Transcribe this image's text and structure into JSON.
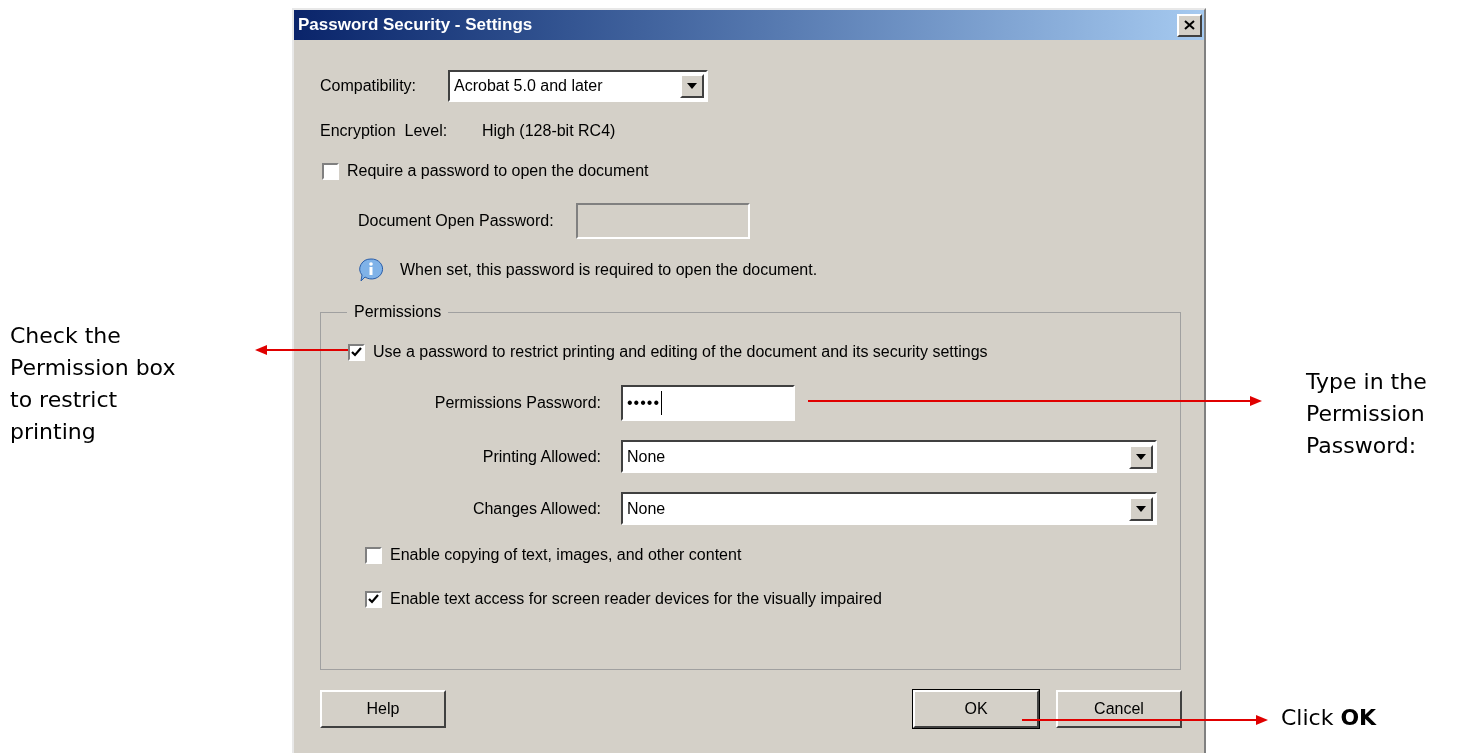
{
  "window": {
    "title": "Password Security - Settings"
  },
  "compatibility": {
    "label": "Compatibility:",
    "value": "Acrobat 5.0 and later"
  },
  "encryption": {
    "label": "Encryption  Level:",
    "value": "High (128-bit RC4)"
  },
  "open_password": {
    "checkbox": {
      "label": "Require a password to open the document",
      "checked": false
    },
    "field": {
      "label": "Document Open Password:",
      "disabled": true
    },
    "info": "When set, this password is required to open the document."
  },
  "permissions": {
    "title": "Permissions",
    "restrict": {
      "label": "Use a password to restrict printing and editing of the document and its security settings",
      "checked": true
    },
    "password": {
      "label": "Permissions Password:",
      "value": "•••••"
    },
    "dropdowns": [
      {
        "label": "Printing Allowed:",
        "value": "None"
      },
      {
        "label": "Changes Allowed:",
        "value": "None"
      }
    ],
    "options": [
      {
        "label": "Enable copying of text, images, and other content",
        "checked": false
      },
      {
        "label": "Enable text access for screen reader devices for the visually impaired",
        "checked": true
      }
    ]
  },
  "buttons": [
    {
      "label": "Help",
      "default": false
    },
    {
      "label": "OK",
      "default": true
    },
    {
      "label": "Cancel",
      "default": false
    }
  ],
  "annotations": [
    {
      "text": "Check the Permission box to restrict printing"
    },
    {
      "text": "Type in the Permission Password:"
    },
    {
      "text": "Click **OK**"
    }
  ]
}
